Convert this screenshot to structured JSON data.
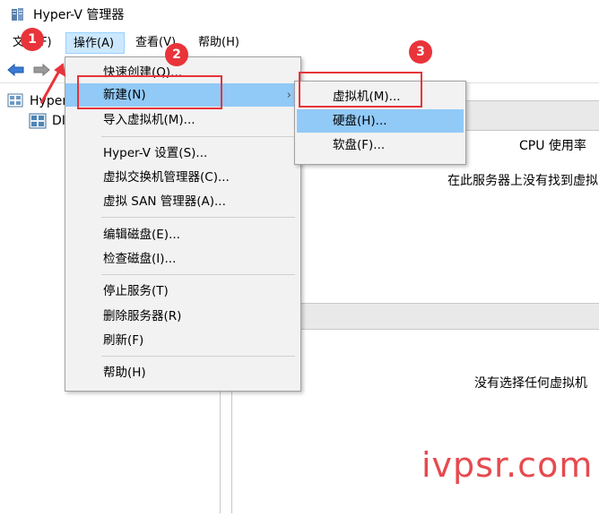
{
  "window": {
    "title": "Hyper-V 管理器"
  },
  "menubar": {
    "items": [
      "文件(F)",
      "操作(A)",
      "查看(V)",
      "帮助(H)"
    ],
    "active": "操作(A)"
  },
  "tree": {
    "items": [
      {
        "label": "Hyper"
      },
      {
        "label": "DI"
      }
    ]
  },
  "right_pane": {
    "column_header_cpu": "CPU 使用率",
    "empty_vm_message": "在此服务器上没有找到虚拟",
    "no_selection_message": "没有选择任何虚拟机"
  },
  "action_menu": {
    "items": [
      {
        "label": "快速创建(Q)..."
      },
      {
        "label": "新建(N)",
        "submenu_arrow": "›"
      },
      {
        "label": "导入虚拟机(M)..."
      },
      {
        "label": "Hyper-V 设置(S)..."
      },
      {
        "label": "虚拟交换机管理器(C)..."
      },
      {
        "label": "虚拟 SAN 管理器(A)..."
      },
      {
        "label": "编辑磁盘(E)..."
      },
      {
        "label": "检查磁盘(I)..."
      },
      {
        "label": "停止服务(T)"
      },
      {
        "label": "删除服务器(R)"
      },
      {
        "label": "刷新(F)"
      },
      {
        "label": "帮助(H)"
      }
    ]
  },
  "new_submenu": {
    "items": [
      {
        "label": "虚拟机(M)..."
      },
      {
        "label": "硬盘(H)..."
      },
      {
        "label": "软盘(F)..."
      }
    ],
    "highlighted": "硬盘(H)..."
  },
  "annotations": {
    "badges": [
      "1",
      "2",
      "3"
    ],
    "color": "#e8343a"
  },
  "watermark": "ivpsr.com",
  "colors": {
    "menu_highlight": "#91c9f7",
    "menubar_active": "#cce8ff",
    "annotation_red": "#e8343a"
  },
  "icons": [
    "hyperv-app-icon",
    "back-arrow-icon",
    "forward-arrow-icon",
    "server-tree-icon",
    "server-node-icon",
    "submenu-arrow-icon"
  ]
}
